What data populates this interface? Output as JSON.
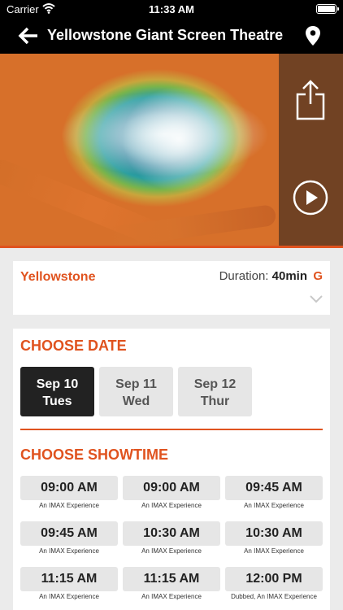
{
  "status_bar": {
    "carrier": "Carrier",
    "time": "11:33 AM"
  },
  "nav": {
    "title": "Yellowstone Giant Screen Theatre",
    "back_icon": "arrow-left-icon",
    "location_icon": "map-pin-icon"
  },
  "hero": {
    "share_icon": "share-icon",
    "play_icon": "play-icon"
  },
  "movie": {
    "name": "Yellowstone",
    "duration_label": "Duration:",
    "duration_value": "40min",
    "rating": "G"
  },
  "choose_date": {
    "title": "CHOOSE DATE",
    "dates": [
      {
        "day": "Sep 10",
        "weekday": "Tues",
        "selected": true
      },
      {
        "day": "Sep 11",
        "weekday": "Wed",
        "selected": false
      },
      {
        "day": "Sep 12",
        "weekday": "Thur",
        "selected": false
      }
    ]
  },
  "choose_showtime": {
    "title": "CHOOSE SHOWTIME",
    "showtimes": [
      {
        "time": "09:00 AM",
        "label": "An IMAX Experience"
      },
      {
        "time": "09:00 AM",
        "label": "An IMAX Experience"
      },
      {
        "time": "09:45 AM",
        "label": "An IMAX Experience"
      },
      {
        "time": "09:45 AM",
        "label": "An IMAX Experience"
      },
      {
        "time": "10:30 AM",
        "label": "An IMAX Experience"
      },
      {
        "time": "10:30 AM",
        "label": "An IMAX Experience"
      },
      {
        "time": "11:15 AM",
        "label": "An IMAX Experience"
      },
      {
        "time": "11:15 AM",
        "label": "An IMAX Experience"
      },
      {
        "time": "12:00 PM",
        "label": "Dubbed, An IMAX Experience"
      }
    ]
  },
  "colors": {
    "accent": "#e0531f",
    "selected_date_bg": "#222222",
    "button_bg": "#e6e6e6",
    "page_bg": "#ebebeb"
  }
}
